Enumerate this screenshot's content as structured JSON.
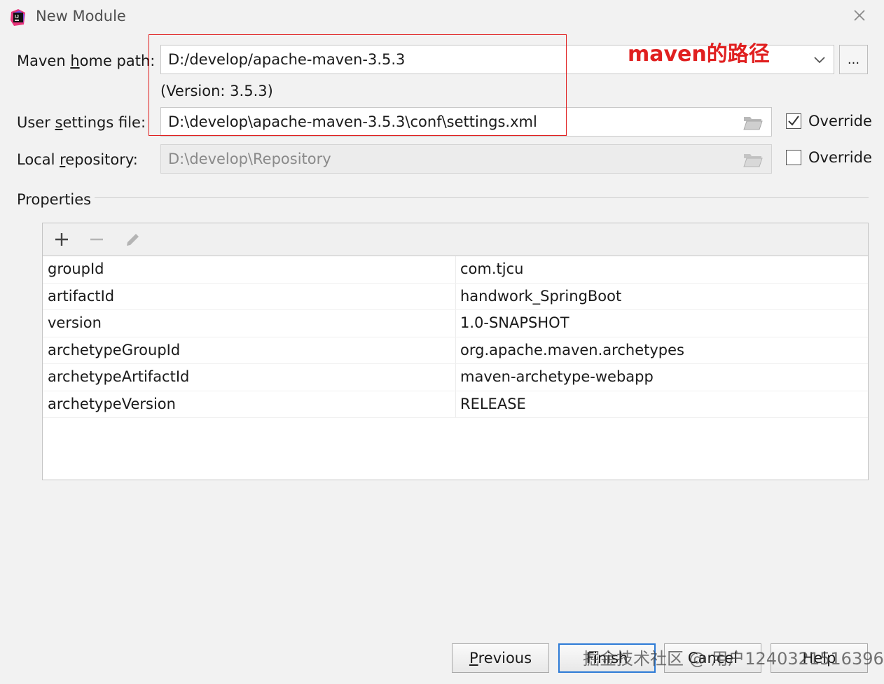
{
  "window": {
    "title": "New Module"
  },
  "form": {
    "maven_home_label_pre": "Maven ",
    "maven_home_label_u": "h",
    "maven_home_label_post": "ome path:",
    "maven_home_value": "D:/develop/apache-maven-3.5.3",
    "version_text": "(Version: 3.5.3)",
    "user_settings_label_pre": "User ",
    "user_settings_label_u": "s",
    "user_settings_label_post": "ettings file:",
    "user_settings_value": "D:\\develop\\apache-maven-3.5.3\\conf\\settings.xml",
    "user_settings_override": "Override",
    "user_settings_override_checked": true,
    "local_repo_label_pre": "Local ",
    "local_repo_label_u": "r",
    "local_repo_label_post": "epository:",
    "local_repo_value": "D:\\develop\\Repository",
    "local_repo_override": "Override",
    "local_repo_override_checked": false,
    "browse_label": "..."
  },
  "annotation": {
    "text": "maven的路径",
    "color": "#e02020"
  },
  "properties": {
    "section_title": "Properties",
    "rows": [
      {
        "key": "groupId",
        "value": "com.tjcu"
      },
      {
        "key": "artifactId",
        "value": "handwork_SpringBoot"
      },
      {
        "key": "version",
        "value": "1.0-SNAPSHOT"
      },
      {
        "key": "archetypeGroupId",
        "value": "org.apache.maven.archetypes"
      },
      {
        "key": "archetypeArtifactId",
        "value": "maven-archetype-webapp"
      },
      {
        "key": "archetypeVersion",
        "value": "RELEASE"
      }
    ]
  },
  "buttons": {
    "previous_u": "P",
    "previous_rest": "revious",
    "finish": "Finish",
    "cancel": "Cancel",
    "help": "Help"
  },
  "watermark": {
    "text": "掘金技术社区 @ 用户1240321516396"
  },
  "colors": {
    "accent": "#2d7bd6",
    "annotation": "#e02020"
  }
}
